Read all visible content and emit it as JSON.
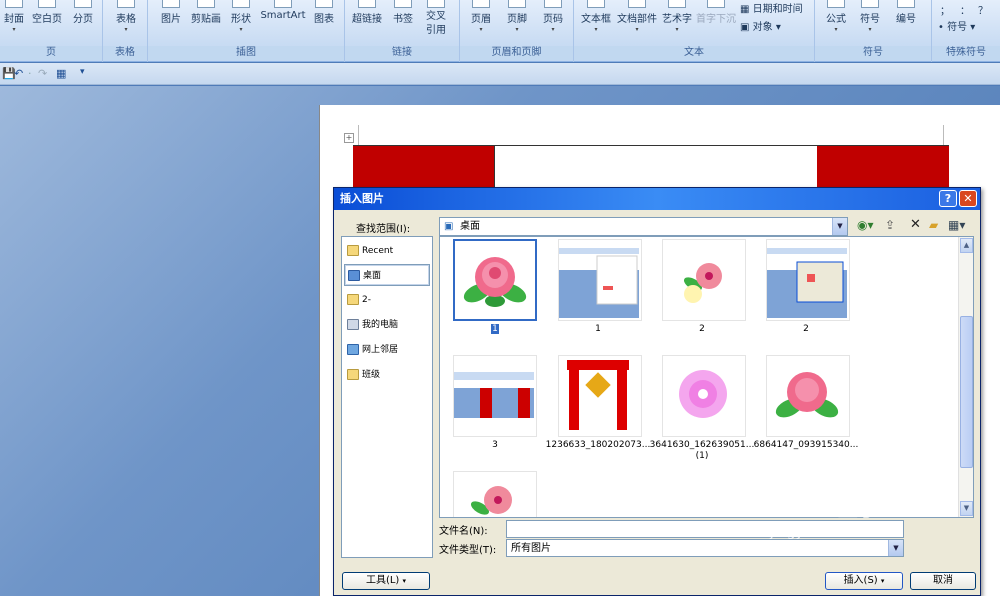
{
  "ribbon": {
    "groups": [
      {
        "label": "页",
        "buttons": [
          "封面",
          "空白页",
          "分页"
        ]
      },
      {
        "label": "表格",
        "buttons": [
          "表格"
        ]
      },
      {
        "label": "插图",
        "buttons": [
          "图片",
          "剪贴画",
          "形状",
          "SmartArt",
          "图表"
        ]
      },
      {
        "label": "链接",
        "buttons": [
          "超链接",
          "书签",
          "交叉引用"
        ]
      },
      {
        "label": "页眉和页脚",
        "buttons": [
          "页眉",
          "页脚",
          "页码"
        ]
      },
      {
        "label": "文本",
        "buttons": [
          "文本框",
          "文档部件",
          "艺术字",
          "首字下沉"
        ],
        "side": [
          "日期和时间",
          "对象"
        ]
      },
      {
        "label": "符号",
        "buttons": [
          "公式",
          "符号",
          "编号"
        ]
      },
      {
        "label": "特殊符号",
        "buttons": [
          "；",
          "：",
          "？"
        ],
        "side": [
          "符号"
        ]
      }
    ]
  },
  "qat": {
    "items": [
      "💾",
      "↶",
      "·",
      "↷",
      "▦",
      "▾"
    ]
  },
  "dialog": {
    "title": "插入图片",
    "help": "?",
    "close": "✕",
    "lookin_label": "查找范围(I):",
    "lookin_value": "桌面",
    "places": [
      "Recent",
      "桌面",
      "2-",
      "我的电脑",
      "网上邻居",
      "班级"
    ],
    "files": [
      "1",
      "1",
      "2",
      "2",
      "3",
      "1236633_180202073...",
      "3641630_162639051...(1)",
      "6864147_093915340...",
      ""
    ],
    "filename_label": "文件名(N):",
    "filename_value": "",
    "filetype_label": "文件类型(T):",
    "filetype_value": "所有图片",
    "tools_button": "工具(L)",
    "insert_button": "插入(S)",
    "cancel_button": "取消"
  },
  "watermark": {
    "brand": "Bai 经验",
    "url": "jingyan.baidu.com"
  },
  "colors": {
    "accent": "#316ac5",
    "table_red": "#c00000",
    "titlebar": "#0a4dd6"
  }
}
